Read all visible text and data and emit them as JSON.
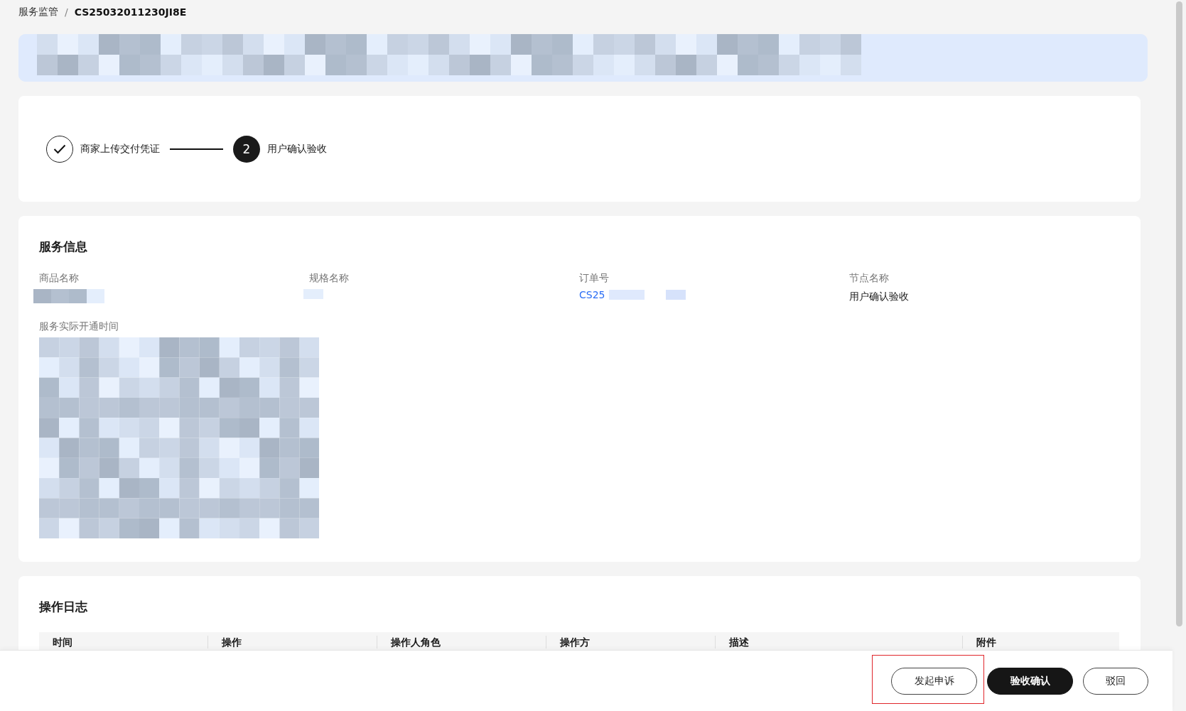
{
  "breadcrumb": [
    {
      "label": "服务监管",
      "current": false
    },
    {
      "label": "CS25032011230JI8E",
      "current": true
    }
  ],
  "breadcrumb_separator": "/",
  "steps": [
    {
      "label": "商家上传交付凭证",
      "completed": true
    },
    {
      "label": "用户确认验收",
      "completed": false,
      "number": "2"
    }
  ],
  "service_info": {
    "title": "服务信息",
    "fields": [
      {
        "label": "商品名称",
        "kind": "redacted"
      },
      {
        "label": "规格名称",
        "kind": "redacted"
      },
      {
        "label": "订单号",
        "kind": "link",
        "value": "CS25"
      },
      {
        "label": "节点名称",
        "kind": "text",
        "value": "用户确认验收"
      },
      {
        "label": "服务实际开通时间",
        "kind": "image"
      }
    ]
  },
  "operation_log": {
    "title": "操作日志",
    "columns": [
      "时间",
      "操作",
      "操作人角色",
      "操作方",
      "描述",
      "附件"
    ]
  },
  "footer": {
    "buttons": [
      {
        "label": "发起申诉",
        "kind": "outline",
        "highlighted": true
      },
      {
        "label": "验收确认",
        "kind": "primary",
        "highlighted": false
      },
      {
        "label": "驳回",
        "kind": "outline",
        "highlighted": false
      }
    ]
  }
}
